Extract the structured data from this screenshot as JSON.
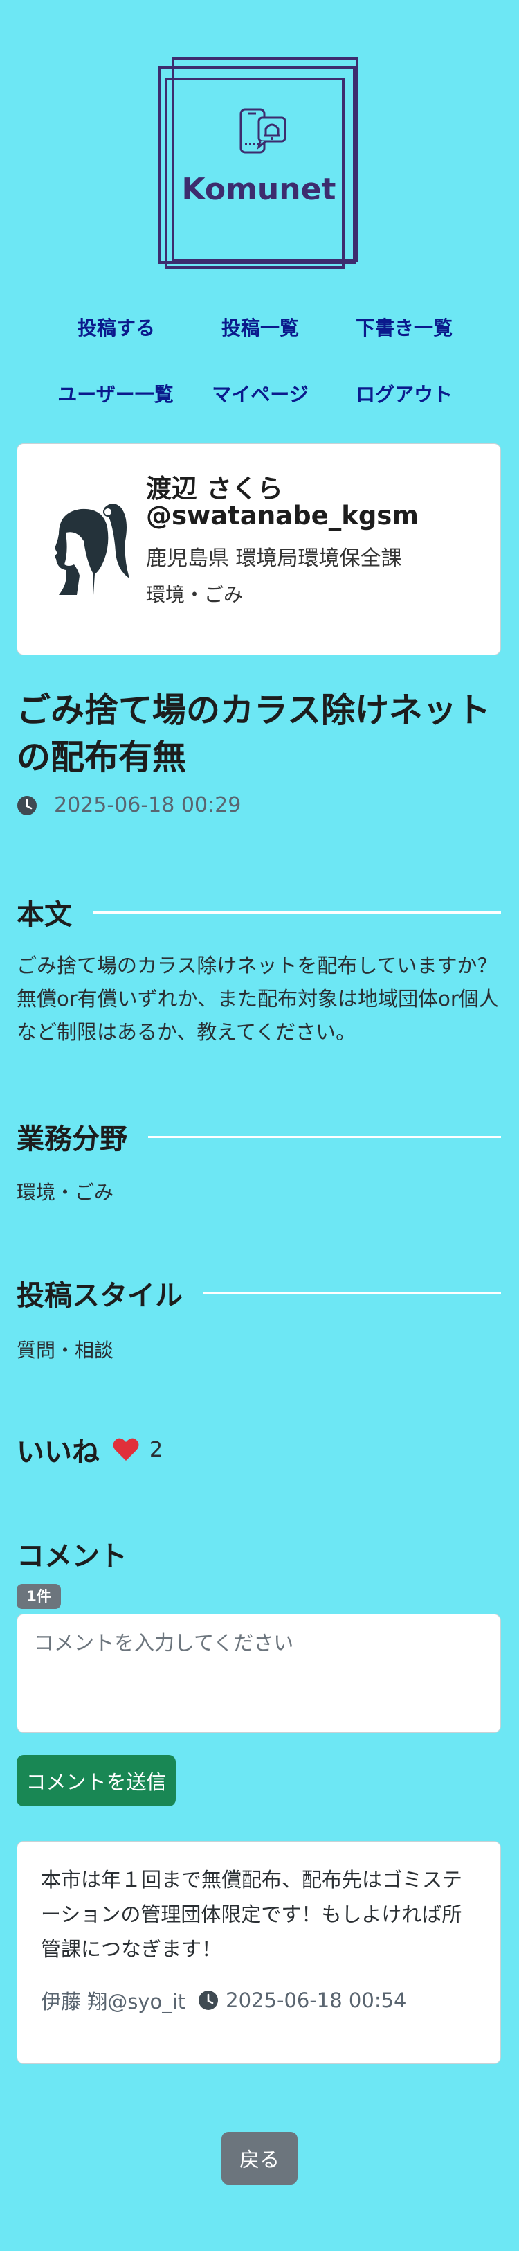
{
  "logo": {
    "text": "Komunet",
    "icon": "phone-bell-icon"
  },
  "nav": {
    "post": "投稿する",
    "post_list": "投稿一覧",
    "drafts": "下書き一覧",
    "users": "ユーザー一覧",
    "mypage": "マイページ",
    "logout": "ログアウト"
  },
  "profile": {
    "name": "渡辺 さくら",
    "handle": "@swatanabe_kgsm",
    "org": "鹿児島県 環境局環境保全課",
    "field": "環境・ごみ",
    "avatar_icon": "user-silhouette-icon"
  },
  "post": {
    "title": "ごみ捨て場のカラス除けネットの配布有無",
    "date": "2025-06-18 00:29",
    "body_heading": "本文",
    "body": "ごみ捨て場のカラス除けネットを配布していますか？無償or有償いずれか、また配布対象は地域団体or個人など制限はあるか、教えてください。",
    "field_heading": "業務分野",
    "field": "環境・ごみ",
    "style_heading": "投稿スタイル",
    "style": "質問・相談"
  },
  "likes": {
    "label": "いいね",
    "count": "2",
    "icon": "heart-icon",
    "color": "#e0303a"
  },
  "comments": {
    "heading": "コメント",
    "count_badge": "1件",
    "placeholder": "コメントを入力してください",
    "submit_label": "コメントを送信",
    "items": [
      {
        "text": "本市は年１回まで無償配布、配布先はゴミステーションの管理団体限定です！もしよければ所管課につなぎます！",
        "author": "伊藤 翔@syo_it",
        "date": "2025-06-18 00:54"
      }
    ]
  },
  "back_label": "戻る",
  "colors": {
    "background": "#6de7f4",
    "logo": "#3d2c6e",
    "nav_link": "#0b1a8c",
    "send_button": "#198754",
    "secondary_button": "#6c757d"
  }
}
